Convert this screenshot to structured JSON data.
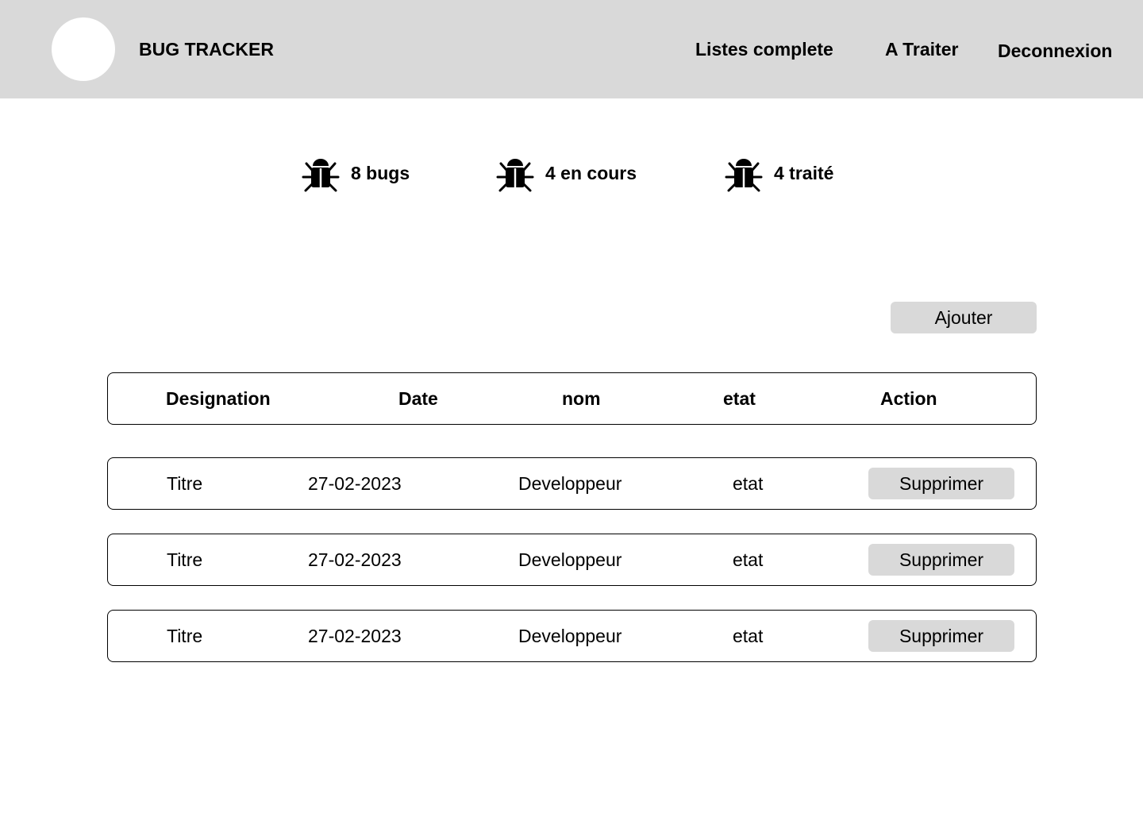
{
  "header": {
    "title": "BUG TRACKER",
    "nav": {
      "full_list": "Listes complete",
      "to_process": "A Traiter",
      "logout": "Deconnexion"
    }
  },
  "stats": [
    {
      "icon": "bug-icon",
      "label": "8 bugs"
    },
    {
      "icon": "bug-icon",
      "label": "4 en cours"
    },
    {
      "icon": "bug-icon",
      "label": "4 traité"
    }
  ],
  "actions": {
    "add_label": "Ajouter"
  },
  "table": {
    "columns": [
      "Designation",
      "Date",
      "nom",
      "etat",
      "Action"
    ],
    "rows": [
      {
        "designation": "Titre",
        "date": "27-02-2023",
        "nom": "Developpeur",
        "etat": "etat",
        "action": "Supprimer"
      },
      {
        "designation": "Titre",
        "date": "27-02-2023",
        "nom": "Developpeur",
        "etat": "etat",
        "action": "Supprimer"
      },
      {
        "designation": "Titre",
        "date": "27-02-2023",
        "nom": "Developpeur",
        "etat": "etat",
        "action": "Supprimer"
      }
    ]
  },
  "colors": {
    "header_bg": "#d9d9d9",
    "button_bg": "#d9d9d9",
    "border": "#000000",
    "text": "#000000"
  }
}
